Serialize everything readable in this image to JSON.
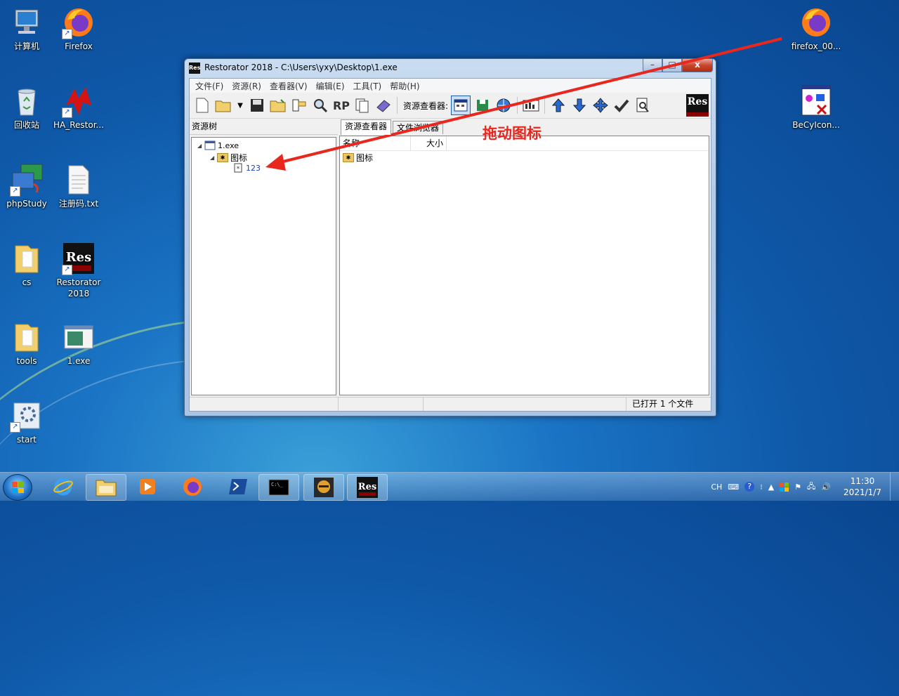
{
  "desktop": {
    "icons": [
      {
        "name": "computer-icon",
        "label": "计算机"
      },
      {
        "name": "firefox-icon",
        "label": "Firefox"
      },
      {
        "name": "recycle-bin-icon",
        "label": "回收站"
      },
      {
        "name": "ha-restorator-icon",
        "label": "HA_Restor..."
      },
      {
        "name": "phpstudy-icon",
        "label": "phpStudy"
      },
      {
        "name": "txt-file-icon",
        "label": "注册码.txt"
      },
      {
        "name": "folder-cs-icon",
        "label": "cs"
      },
      {
        "name": "restorator-icon",
        "label": "Restorator 2018"
      },
      {
        "name": "folder-tools-icon",
        "label": "tools"
      },
      {
        "name": "exe-file-icon",
        "label": "1.exe"
      },
      {
        "name": "start-app-icon",
        "label": "start"
      },
      {
        "name": "firefox-file-icon",
        "label": "firefox_00..."
      },
      {
        "name": "becyicon-icon",
        "label": "BeCyIcon..."
      }
    ]
  },
  "window": {
    "app_icon": "Res",
    "title": "Restorator 2018 - C:\\Users\\yxy\\Desktop\\1.exe",
    "close_glyph": "x",
    "menu": [
      "文件(F)",
      "资源(R)",
      "查看器(V)",
      "编辑(E)",
      "工具(T)",
      "帮助(H)"
    ],
    "toolbar_label": "资源查看器:",
    "logo": "Res",
    "left_header": "资源树",
    "tree": {
      "root": "1.exe",
      "folder": "图标",
      "leaf": "123"
    },
    "tabs": [
      "资源查看器",
      "文件浏览器"
    ],
    "columns": [
      "名称",
      "大小"
    ],
    "rows": [
      {
        "name": "图标",
        "size": ""
      }
    ],
    "status": "已打开 1 个文件"
  },
  "annotation": "拖动图标",
  "taskbar": {
    "tray_lang": "CH",
    "time": "11:30",
    "date": "2021/1/7"
  },
  "colors": {
    "annotation": "#e8281f",
    "title_bar": "#b3cbe8",
    "desktop": "#1a73c4"
  }
}
